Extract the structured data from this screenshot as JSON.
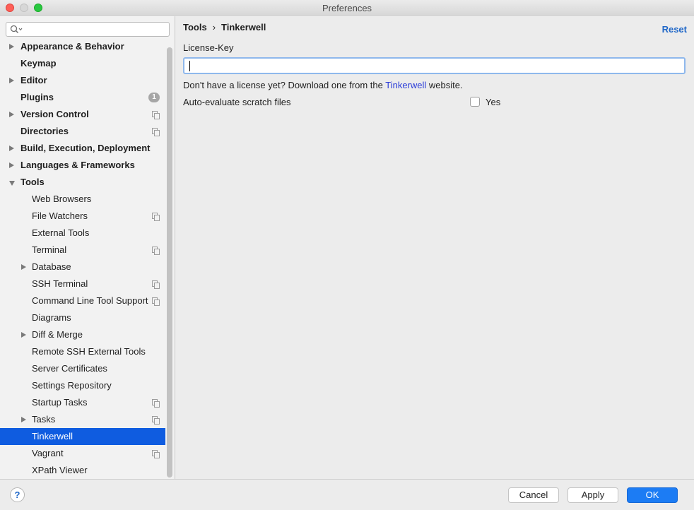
{
  "window": {
    "title": "Preferences"
  },
  "search": {
    "placeholder": ""
  },
  "sidebar": {
    "items": [
      {
        "label": "Appearance & Behavior",
        "level": 0,
        "arrow": "right",
        "marker": "none"
      },
      {
        "label": "Keymap",
        "level": 0,
        "arrow": "none",
        "marker": "none"
      },
      {
        "label": "Editor",
        "level": 0,
        "arrow": "right",
        "marker": "none"
      },
      {
        "label": "Plugins",
        "level": 0,
        "arrow": "none",
        "marker": "badge",
        "badge": "1"
      },
      {
        "label": "Version Control",
        "level": 0,
        "arrow": "right",
        "marker": "copy"
      },
      {
        "label": "Directories",
        "level": 0,
        "arrow": "none",
        "marker": "copy"
      },
      {
        "label": "Build, Execution, Deployment",
        "level": 0,
        "arrow": "right",
        "marker": "none"
      },
      {
        "label": "Languages & Frameworks",
        "level": 0,
        "arrow": "right",
        "marker": "none"
      },
      {
        "label": "Tools",
        "level": 0,
        "arrow": "down",
        "marker": "none"
      },
      {
        "label": "Web Browsers",
        "level": 1,
        "arrow": "none",
        "marker": "none"
      },
      {
        "label": "File Watchers",
        "level": 1,
        "arrow": "none",
        "marker": "copy"
      },
      {
        "label": "External Tools",
        "level": 1,
        "arrow": "none",
        "marker": "none"
      },
      {
        "label": "Terminal",
        "level": 1,
        "arrow": "none",
        "marker": "copy"
      },
      {
        "label": "Database",
        "level": 1,
        "arrow": "right",
        "marker": "none"
      },
      {
        "label": "SSH Terminal",
        "level": 1,
        "arrow": "none",
        "marker": "copy"
      },
      {
        "label": "Command Line Tool Support",
        "level": 1,
        "arrow": "none",
        "marker": "copy"
      },
      {
        "label": "Diagrams",
        "level": 1,
        "arrow": "none",
        "marker": "none"
      },
      {
        "label": "Diff & Merge",
        "level": 1,
        "arrow": "right",
        "marker": "none"
      },
      {
        "label": "Remote SSH External Tools",
        "level": 1,
        "arrow": "none",
        "marker": "none"
      },
      {
        "label": "Server Certificates",
        "level": 1,
        "arrow": "none",
        "marker": "none"
      },
      {
        "label": "Settings Repository",
        "level": 1,
        "arrow": "none",
        "marker": "none"
      },
      {
        "label": "Startup Tasks",
        "level": 1,
        "arrow": "none",
        "marker": "copy"
      },
      {
        "label": "Tasks",
        "level": 1,
        "arrow": "right",
        "marker": "copy"
      },
      {
        "label": "Tinkerwell",
        "level": 1,
        "arrow": "none",
        "marker": "none",
        "selected": true
      },
      {
        "label": "Vagrant",
        "level": 1,
        "arrow": "none",
        "marker": "copy"
      },
      {
        "label": "XPath Viewer",
        "level": 1,
        "arrow": "none",
        "marker": "none"
      }
    ]
  },
  "main": {
    "breadcrumb": {
      "parent": "Tools",
      "separator": "›",
      "current": "Tinkerwell"
    },
    "reset_label": "Reset",
    "license_label": "License-Key",
    "license_value": "",
    "hint_prefix": "Don't have a license yet? Download one from the",
    "hint_link": "Tinkerwell",
    "hint_suffix": "website.",
    "auto_evaluate_label": "Auto-evaluate scratch files",
    "auto_evaluate_checked": false,
    "auto_evaluate_option": "Yes"
  },
  "footer": {
    "help_label": "?",
    "cancel_label": "Cancel",
    "apply_label": "Apply",
    "ok_label": "OK"
  },
  "colors": {
    "selection": "#0f5ce0",
    "link": "#2a3cd8",
    "reset_link": "#2168c8",
    "ok_button": "#1c7cf4",
    "close": "#fe5f57",
    "maximize": "#28c840"
  }
}
